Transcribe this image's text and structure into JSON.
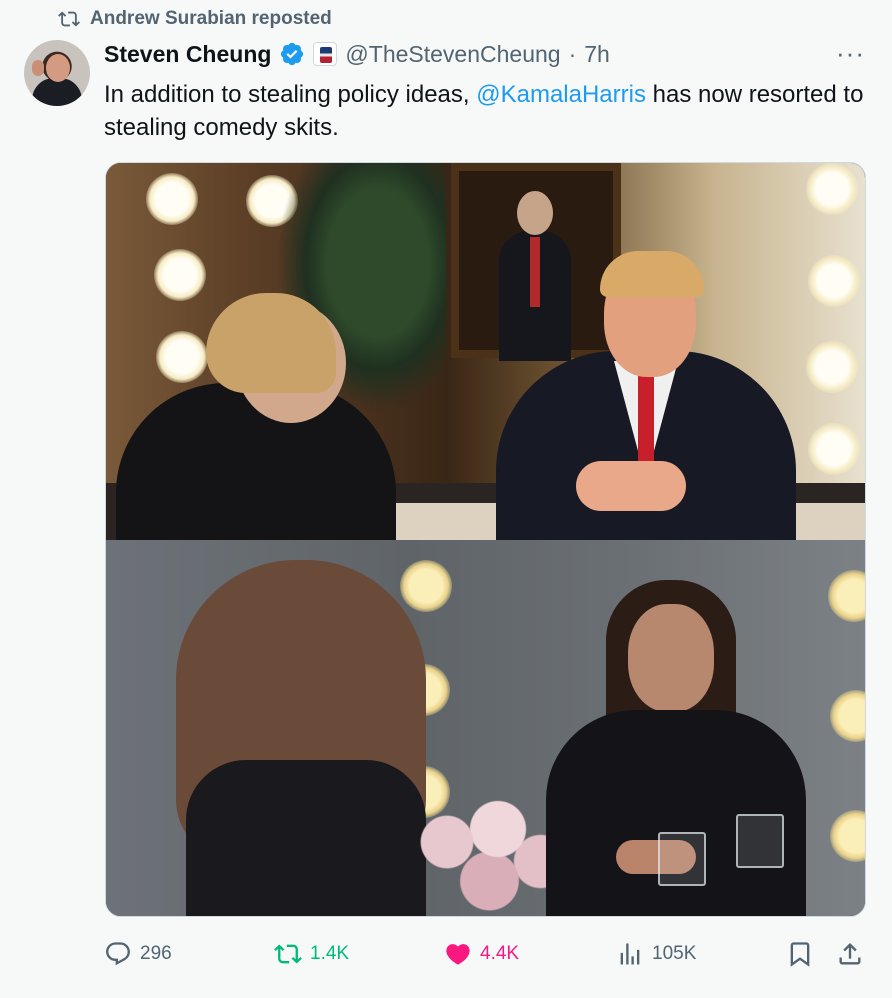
{
  "repost": {
    "text": "Andrew Surabian reposted"
  },
  "author": {
    "name": "Steven Cheung",
    "handle": "@TheStevenCheung",
    "separator": "·",
    "time": "7h"
  },
  "tweet": {
    "text_before": "In addition to stealing policy ideas, ",
    "mention": "@KamalaHarris",
    "text_after": " has now resorted to stealing comedy skits."
  },
  "more_label": "···",
  "actions": {
    "replies": "296",
    "reposts": "1.4K",
    "likes": "4.4K",
    "views": "105K"
  },
  "colors": {
    "accent": "#1d9bf0",
    "repost": "#00ba7c",
    "like": "#f91880",
    "muted": "#536471"
  },
  "icons": [
    "repost-icon",
    "verified-icon",
    "affiliate-badge-icon",
    "more-icon",
    "reply-icon",
    "like-icon",
    "views-icon",
    "bookmark-icon",
    "share-icon"
  ]
}
